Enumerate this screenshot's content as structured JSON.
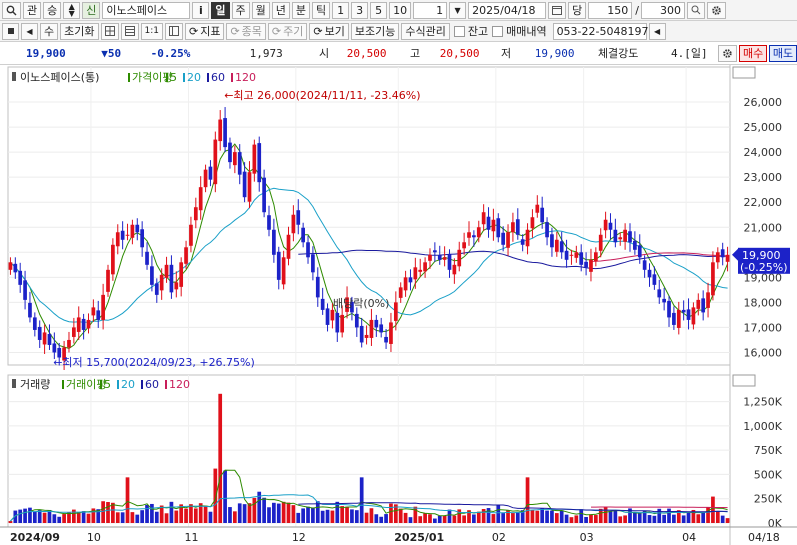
{
  "toolbar1": {
    "search_icon": "search-icon",
    "btn_kwan": "관",
    "btn_seung": "승",
    "badge_sin": "신",
    "stock_name": "이노스페이스",
    "info_icon": "i",
    "period_day": "일",
    "period_week": "주",
    "period_month": "월",
    "period_year": "년",
    "period_min": "분",
    "period_tick": "틱",
    "n1": "1",
    "n3": "3",
    "n5": "5",
    "n10": "10",
    "n_value": "1",
    "date": "2025/04/18",
    "dang": "당",
    "count1": "150",
    "slash": "/",
    "count2": "300",
    "gear": "gear-icon"
  },
  "toolbar2": {
    "su": "수",
    "reset": "초기화",
    "one_one": "1:1",
    "indicator": "지표",
    "jongmok": "종목",
    "jugi": "주기",
    "view": "보기",
    "aux": "보조기능",
    "formula": "수식관리",
    "remain": "잔고",
    "trade_hist": "매매내역",
    "phone": "053-22-5048197"
  },
  "quote": {
    "price": "19,900",
    "change": "▼50",
    "rate": "-0.25%",
    "volume": "1,973",
    "open_label": "시",
    "open": "20,500",
    "high_label": "고",
    "high": "20,500",
    "low_label": "저",
    "low": "19,900",
    "strength_label": "체결강도",
    "strength": "4.[일]",
    "buy": "매수",
    "sell": "매도"
  },
  "chart_data": [
    {
      "type": "candlestick",
      "title": "이노스페이스(통)",
      "legend": [
        "가격이평",
        "5",
        "20",
        "60",
        "120"
      ],
      "legend_colors": [
        "#2e8b00",
        "#2e8b00",
        "#1aa0c8",
        "#1a1a9e",
        "#c81e5a"
      ],
      "x_labels": [
        "2024/09",
        "10",
        "11",
        "12",
        "2025/01",
        "02",
        "03",
        "04"
      ],
      "y_ticks": [
        "26,000",
        "25,000",
        "24,000",
        "23,000",
        "22,000",
        "21,000",
        "20,000",
        "19,000",
        "18,000",
        "17,000",
        "16,000"
      ],
      "ylim": [
        15500,
        26600
      ],
      "annotations": {
        "high": "최고 26,000(2024/11/11, -23.46%)",
        "low": "최저 15,700(2024/09/23, +26.75%)",
        "dividend": "배당락(0%)"
      },
      "current_price_label": "19,900",
      "current_rate_label": "(-0.25%)",
      "close": [
        19600,
        19200,
        18700,
        18100,
        17400,
        16900,
        16500,
        16800,
        16300,
        16000,
        15800,
        16200,
        16500,
        17000,
        17400,
        16900,
        17300,
        17800,
        17300,
        18300,
        19300,
        20300,
        20800,
        20500,
        20700,
        21100,
        20800,
        20200,
        19500,
        18700,
        18300,
        19100,
        19500,
        18400,
        18800,
        19600,
        20200,
        21100,
        21800,
        22600,
        23300,
        22900,
        24500,
        25300,
        24200,
        23600,
        24000,
        23100,
        22200,
        23200,
        24300,
        22800,
        21600,
        20900,
        19900,
        18900,
        19800,
        20700,
        21500,
        21100,
        20400,
        19800,
        19200,
        18200,
        17700,
        17100,
        17700,
        16800,
        17500,
        18200,
        17600,
        17000,
        16400,
        16700,
        17300,
        17000,
        16800,
        16400,
        17200,
        18000,
        18600,
        19000,
        18800,
        19400,
        19300,
        19600,
        19900,
        20000,
        19700,
        19800,
        19300,
        19500,
        20100,
        20400,
        20800,
        20600,
        21000,
        21600,
        20900,
        21300,
        20600,
        20300,
        20800,
        21200,
        20700,
        20300,
        20900,
        21400,
        21900,
        21200,
        20600,
        20200,
        20500,
        20000,
        19700,
        19900,
        20000,
        19500,
        19400,
        19700,
        20000,
        20700,
        21300,
        20900,
        20400,
        20600,
        20900,
        20400,
        20100,
        19800,
        19300,
        19000,
        18700,
        18200,
        18000,
        17400,
        17100,
        17700,
        17600,
        17300,
        17800,
        18100,
        17600,
        18400,
        19600,
        20000,
        19800,
        19900
      ],
      "volume_series": {
        "title": "거래량",
        "legend": [
          "거래이평",
          "5",
          "20",
          "60",
          "120"
        ],
        "y_ticks": [
          "1,250K",
          "1,000K",
          "750K",
          "500K",
          "250K",
          "0K"
        ],
        "ylim": [
          0,
          1400
        ]
      },
      "right_date_label": "04/18"
    }
  ]
}
